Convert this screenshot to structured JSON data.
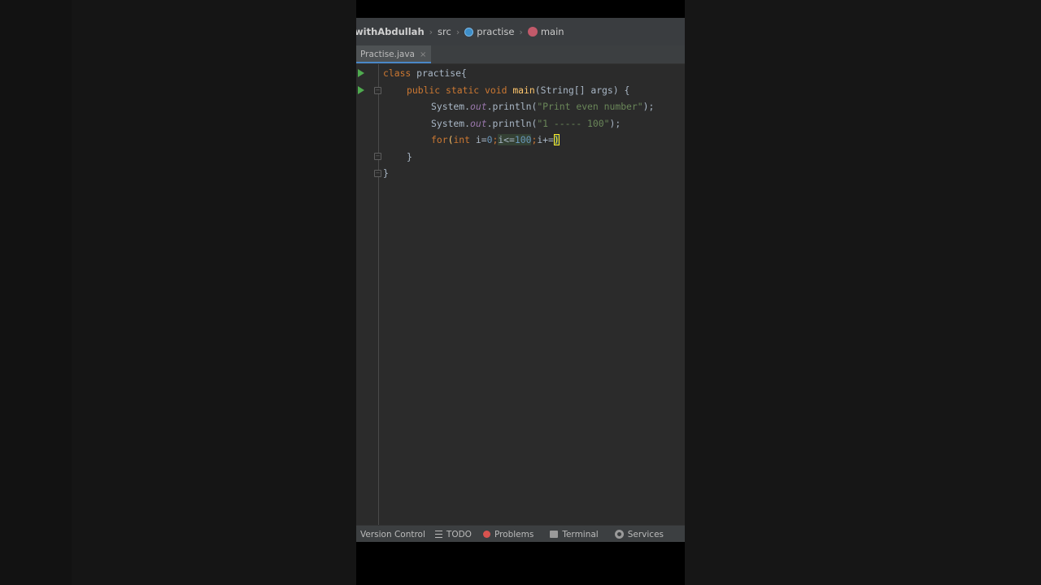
{
  "breadcrumb": {
    "project": "withAbdullah",
    "folder": "src",
    "class_name": "practise",
    "method": "main"
  },
  "tab": {
    "file_name": "Practise.java",
    "close_glyph": "×"
  },
  "code": {
    "line1": {
      "kw": "class",
      "rest": " practise{"
    },
    "line2": {
      "kw1": "public",
      "kw2": "static",
      "kw3": "void",
      "fn": "main",
      "rest": "(String[] args) {"
    },
    "line3": {
      "obj": "System.",
      "fld": "out",
      "call": ".println(",
      "str": "\"Print even number\"",
      "end": ");"
    },
    "line4": {
      "obj": "System.",
      "fld": "out",
      "call": ".println(",
      "str": "\"1 ----- 100\"",
      "end": ");"
    },
    "line5": {
      "kw": "for",
      "paren": "(",
      "kw_int": "int",
      "init": " i=",
      "zero": "0",
      "semi1": ";",
      "cond_a": "i<=",
      "cond_b": "100",
      "semi2": ";",
      "inc": "i+=",
      "caret_char": ")"
    },
    "line6": {
      "text": "}"
    },
    "line7": {
      "text": "}"
    }
  },
  "statusbar": {
    "version_control": "Version Control",
    "todo": "TODO",
    "problems": "Problems",
    "terminal": "Terminal",
    "services": "Services"
  },
  "colors": {
    "keyword": "#cc7832",
    "function": "#ffc66d",
    "string": "#6a8759",
    "field": "#9876aa",
    "number": "#6897bb",
    "run_icon": "#4fab4f",
    "tab_underline": "#4a88c7"
  }
}
